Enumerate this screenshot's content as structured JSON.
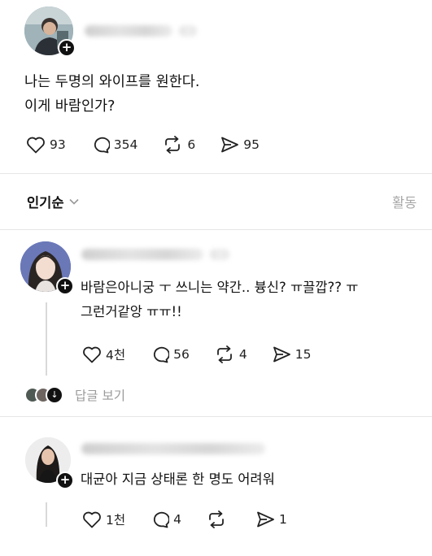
{
  "post": {
    "line1": "나는 두명의 와이프를 원한다.",
    "line2": "이게 바람인가?",
    "actions": {
      "like_count": "93",
      "comment_count": "354",
      "repost_count": "6",
      "share_count": "95"
    }
  },
  "sort": {
    "label": "인기순",
    "activity_label": "활동"
  },
  "replies": [
    {
      "line1": "바람은아니궁 ㅜ 쓰니는 약간.. 븅신? ㅠ끌깝?? ㅠ",
      "line2": "그런거같앙 ㅠㅠ!!",
      "like_count": "4천",
      "comment_count": "56",
      "repost_count": "4",
      "share_count": "15",
      "view_replies_label": "답글 보기"
    },
    {
      "line1": "대균아 지금 상태론 한 명도 어려워",
      "like_count": "1천",
      "comment_count": "4",
      "repost_count": "",
      "share_count": "1"
    }
  ],
  "icons": {
    "like": "heart-icon",
    "comment": "comment-bubble-icon",
    "repost": "repost-icon",
    "share": "send-icon",
    "follow": "plus-icon",
    "dropdown": "chevron-down-icon"
  }
}
